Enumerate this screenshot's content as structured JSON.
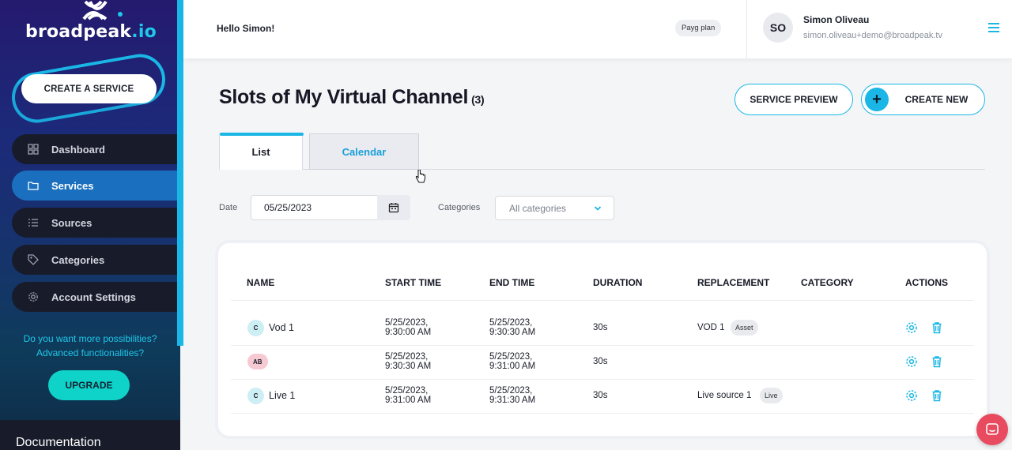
{
  "brand": {
    "name": "broadpeak",
    "tld": ".io"
  },
  "sidebar": {
    "create_label": "CREATE A SERVICE",
    "items": [
      {
        "label": "Dashboard",
        "icon": "grid-icon"
      },
      {
        "label": "Services",
        "icon": "folder-icon"
      },
      {
        "label": "Sources",
        "icon": "list-icon"
      },
      {
        "label": "Categories",
        "icon": "tag-icon"
      },
      {
        "label": "Account Settings",
        "icon": "gear-icon"
      }
    ],
    "promo_line1": "Do you want more possibilities?",
    "promo_line2": "Advanced functionalities?",
    "upgrade_label": "UPGRADE",
    "documentation_label": "Documentation"
  },
  "header": {
    "greeting": "Hello Simon!",
    "plan": "Payg plan",
    "user": {
      "initials": "SO",
      "name": "Simon Oliveau",
      "email": "simon.oliveau+demo@broadpeak.tv"
    }
  },
  "main": {
    "title": "Slots of My Virtual Channel",
    "count": "(3)",
    "preview_label": "SERVICE PREVIEW",
    "create_new_label": "CREATE NEW",
    "tabs": [
      {
        "label": "List"
      },
      {
        "label": "Calendar"
      }
    ],
    "filters": {
      "date_label": "Date",
      "date_value": "05/25/2023",
      "categories_label": "Categories",
      "categories_value": "All categories"
    },
    "table": {
      "headers": [
        "NAME",
        "START TIME",
        "END TIME",
        "DURATION",
        "REPLACEMENT",
        "CATEGORY",
        "ACTIONS"
      ],
      "rows": [
        {
          "badge": "C",
          "name": "Vod 1",
          "start_date": "5/25/2023,",
          "start_time": "9:30:00 AM",
          "end_date": "5/25/2023,",
          "end_time": "9:30:30 AM",
          "duration": "30s",
          "replacement": "VOD 1",
          "replacement_type": "Asset"
        },
        {
          "badge": "AB",
          "name": "",
          "start_date": "5/25/2023,",
          "start_time": "9:30:30 AM",
          "end_date": "5/25/2023,",
          "end_time": "9:31:00 AM",
          "duration": "30s",
          "replacement": "",
          "replacement_type": ""
        },
        {
          "badge": "C",
          "name": "Live 1",
          "start_date": "5/25/2023,",
          "start_time": "9:31:00 AM",
          "end_date": "5/25/2023,",
          "end_time": "9:31:30 AM",
          "duration": "30s",
          "replacement": "Live source 1",
          "replacement_type": "Live"
        }
      ]
    }
  },
  "colors": {
    "accent": "#1ab7e6",
    "sidebar_active": "#1a70bf",
    "upgrade": "#0fd3c8",
    "chat": "#e84a5f"
  }
}
